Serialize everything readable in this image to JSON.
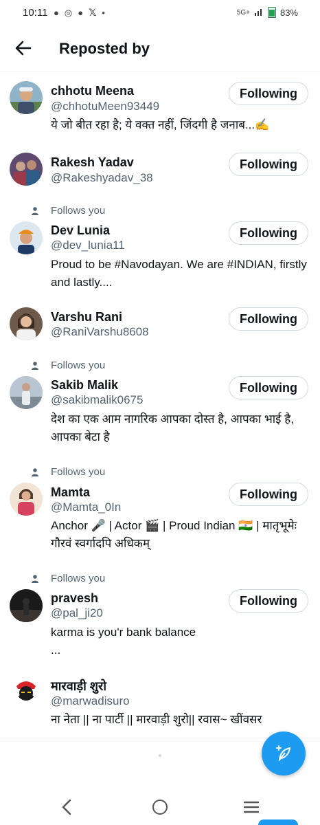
{
  "status_bar": {
    "time": "10:11",
    "dot": "•",
    "network": "5G+",
    "battery_percent": "83%"
  },
  "header": {
    "title": "Reposted by"
  },
  "follows_you_label": "Follows you",
  "users": [
    {
      "name": "chhotu Meena",
      "handle": "@chhotuMeen93449",
      "bio": "ये जो बीत रहा है; ये वक्त नहीं, जिंदगी है जनाब...✍️",
      "follows_you": false,
      "button": "Following"
    },
    {
      "name": "Rakesh Yadav",
      "handle": "@Rakeshyadav_38",
      "bio": "",
      "follows_you": false,
      "button": "Following"
    },
    {
      "name": "Dev Lunia",
      "handle": "@dev_lunia11",
      "bio": "Proud to be #Navodayan. We are #INDIAN, firstly and lastly....",
      "follows_you": true,
      "button": "Following"
    },
    {
      "name": "Varshu Rani",
      "handle": "@RaniVarshu8608",
      "bio": "",
      "follows_you": false,
      "button": "Following"
    },
    {
      "name": "Sakib Malik",
      "handle": "@sakibmalik0675",
      "bio": "देश का एक आम नागरिक आपका दोस्त है, आपका भाई है, आपका बेटा है",
      "follows_you": true,
      "button": "Following"
    },
    {
      "name": "Mamta",
      "handle": "@Mamta_0In",
      "bio": "Anchor 🎤 | Actor 🎬 | Proud Indian 🇮🇳 | मातृभूमेः गौरवं स्वर्गादपि अधिकम्",
      "follows_you": true,
      "button": "Following"
    },
    {
      "name": "pravesh",
      "handle": "@pal_ji20",
      "bio": "karma is you'r bank balance\n...",
      "follows_you": true,
      "button": "Following"
    },
    {
      "name": "मारवाड़ी शुरो",
      "handle": "@marwadisuro",
      "bio": "ना नेता || ना पार्टी || मारवाड़ी शुरो|| रवास~ खींवसर",
      "follows_you": false,
      "button": ""
    }
  ],
  "colors": {
    "accent": "#1d9bf0",
    "text": "#0f1419",
    "secondary": "#536471",
    "border": "#cfd9de"
  },
  "icons": {
    "back": "arrow-left-icon",
    "person": "person-icon",
    "compose": "compose-post-icon"
  }
}
